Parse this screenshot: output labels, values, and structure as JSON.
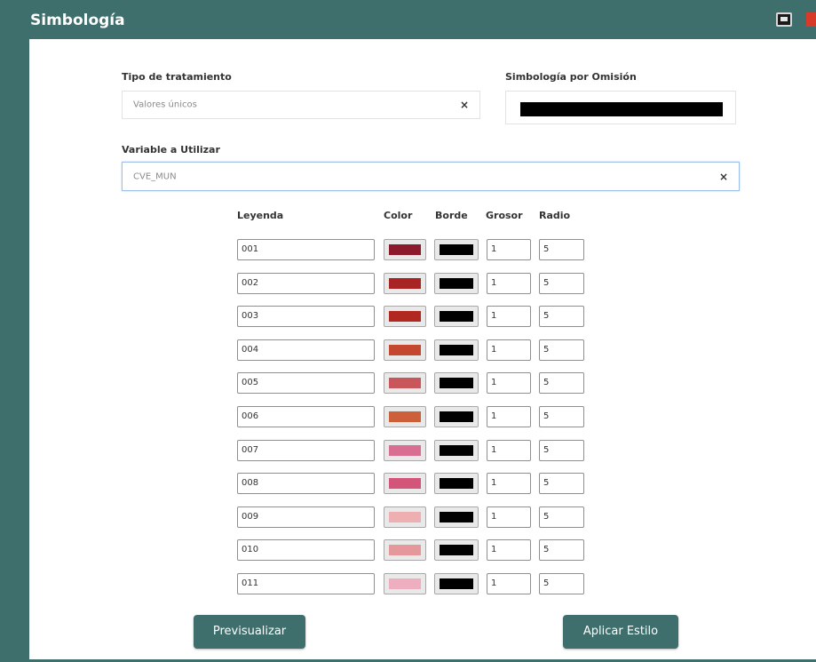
{
  "window": {
    "title": "Simbología"
  },
  "form": {
    "tipo_label": "Tipo de tratamiento",
    "tipo_value": "Valores únicos",
    "omision_label": "Simbología por Omisión",
    "omision_color": "#000000",
    "variable_label": "Variable a Utilizar",
    "variable_value": "CVE_MUN",
    "clear_symbol": "×"
  },
  "table": {
    "headers": [
      "Leyenda",
      "Color",
      "Borde",
      "Grosor",
      "Radio"
    ],
    "rows": [
      {
        "leyenda": "001",
        "color": "#8b1a2c",
        "borde": "#000000",
        "grosor": "1",
        "radio": "5"
      },
      {
        "leyenda": "002",
        "color": "#a82323",
        "borde": "#000000",
        "grosor": "1",
        "radio": "5"
      },
      {
        "leyenda": "003",
        "color": "#b0281f",
        "borde": "#000000",
        "grosor": "1",
        "radio": "5"
      },
      {
        "leyenda": "004",
        "color": "#c4472f",
        "borde": "#000000",
        "grosor": "1",
        "radio": "5"
      },
      {
        "leyenda": "005",
        "color": "#c8565a",
        "borde": "#000000",
        "grosor": "1",
        "radio": "5"
      },
      {
        "leyenda": "006",
        "color": "#cd5f3a",
        "borde": "#000000",
        "grosor": "1",
        "radio": "5"
      },
      {
        "leyenda": "007",
        "color": "#d96e93",
        "borde": "#000000",
        "grosor": "1",
        "radio": "5"
      },
      {
        "leyenda": "008",
        "color": "#d4557a",
        "borde": "#000000",
        "grosor": "1",
        "radio": "5"
      },
      {
        "leyenda": "009",
        "color": "#eeafb3",
        "borde": "#000000",
        "grosor": "1",
        "radio": "5"
      },
      {
        "leyenda": "010",
        "color": "#e6979b",
        "borde": "#000000",
        "grosor": "1",
        "radio": "5"
      },
      {
        "leyenda": "011",
        "color": "#efaec0",
        "borde": "#000000",
        "grosor": "1",
        "radio": "5"
      }
    ]
  },
  "buttons": {
    "preview": "Previsualizar",
    "apply": "Aplicar Estilo"
  },
  "colors": {
    "accent": "#3e6f6c"
  },
  "icons": {
    "save": "save-icon",
    "close": "close-icon"
  }
}
